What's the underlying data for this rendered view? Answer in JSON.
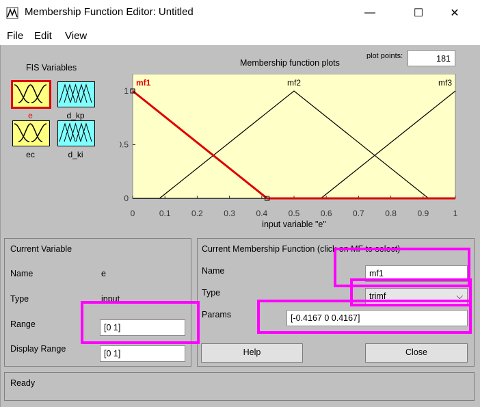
{
  "window": {
    "title": "Membership Function Editor: Untitled",
    "controls": {
      "minimize": "—",
      "maximize": "☐",
      "close": "✕"
    }
  },
  "menu": {
    "file": "File",
    "edit": "Edit",
    "view": "View"
  },
  "fis": {
    "label": "FIS Variables",
    "variables": [
      {
        "name": "e",
        "color": "#ffff80",
        "selected": true
      },
      {
        "name": "d_kp",
        "color": "#80ffff",
        "selected": false
      },
      {
        "name": "ec",
        "color": "#ffff80",
        "selected": false
      },
      {
        "name": "d_ki",
        "color": "#80ffff",
        "selected": false
      }
    ]
  },
  "plot": {
    "title": "Membership function plots",
    "plot_points_label": "plot points:",
    "plot_points": "181",
    "xlabel": "input variable \"e\"",
    "background": "#ffffc8",
    "highlight_color": "#e00000"
  },
  "chart_data": {
    "type": "line",
    "xlabel": "input variable \"e\"",
    "xlim": [
      0,
      1
    ],
    "ylim": [
      0,
      1
    ],
    "xticks": [
      "0",
      "0.1",
      "0.2",
      "0.3",
      "0.4",
      "0.5",
      "0.6",
      "0.7",
      "0.8",
      "0.9",
      "1"
    ],
    "yticks": [
      "0",
      "0.5",
      "1"
    ],
    "series": [
      {
        "name": "mf1",
        "x": [
          0,
          0.4167,
          1
        ],
        "y": [
          1,
          0,
          0
        ],
        "highlight": true
      },
      {
        "name": "mf2",
        "x": [
          0,
          0.0833,
          0.5,
          0.9167,
          1
        ],
        "y": [
          0,
          0,
          1,
          0,
          0
        ],
        "highlight": false
      },
      {
        "name": "mf3",
        "x": [
          0,
          0.5833,
          1
        ],
        "y": [
          0,
          0,
          1
        ],
        "highlight": false
      }
    ]
  },
  "current_variable": {
    "header": "Current Variable",
    "name_label": "Name",
    "name_value": "e",
    "type_label": "Type",
    "type_value": "input",
    "range_label": "Range",
    "range_value": "[0 1]",
    "display_range_label": "Display Range",
    "display_range_value": "[0 1]"
  },
  "current_mf": {
    "header": "Current Membership Function (click on MF to select)",
    "name_label": "Name",
    "name_value": "mf1",
    "type_label": "Type",
    "type_value": "trimf",
    "params_label": "Params",
    "params_value": "[-0.4167 0 0.4167]",
    "help_label": "Help",
    "close_label": "Close"
  },
  "status": {
    "text": "Ready"
  },
  "annotation_color": "#ff00ff"
}
